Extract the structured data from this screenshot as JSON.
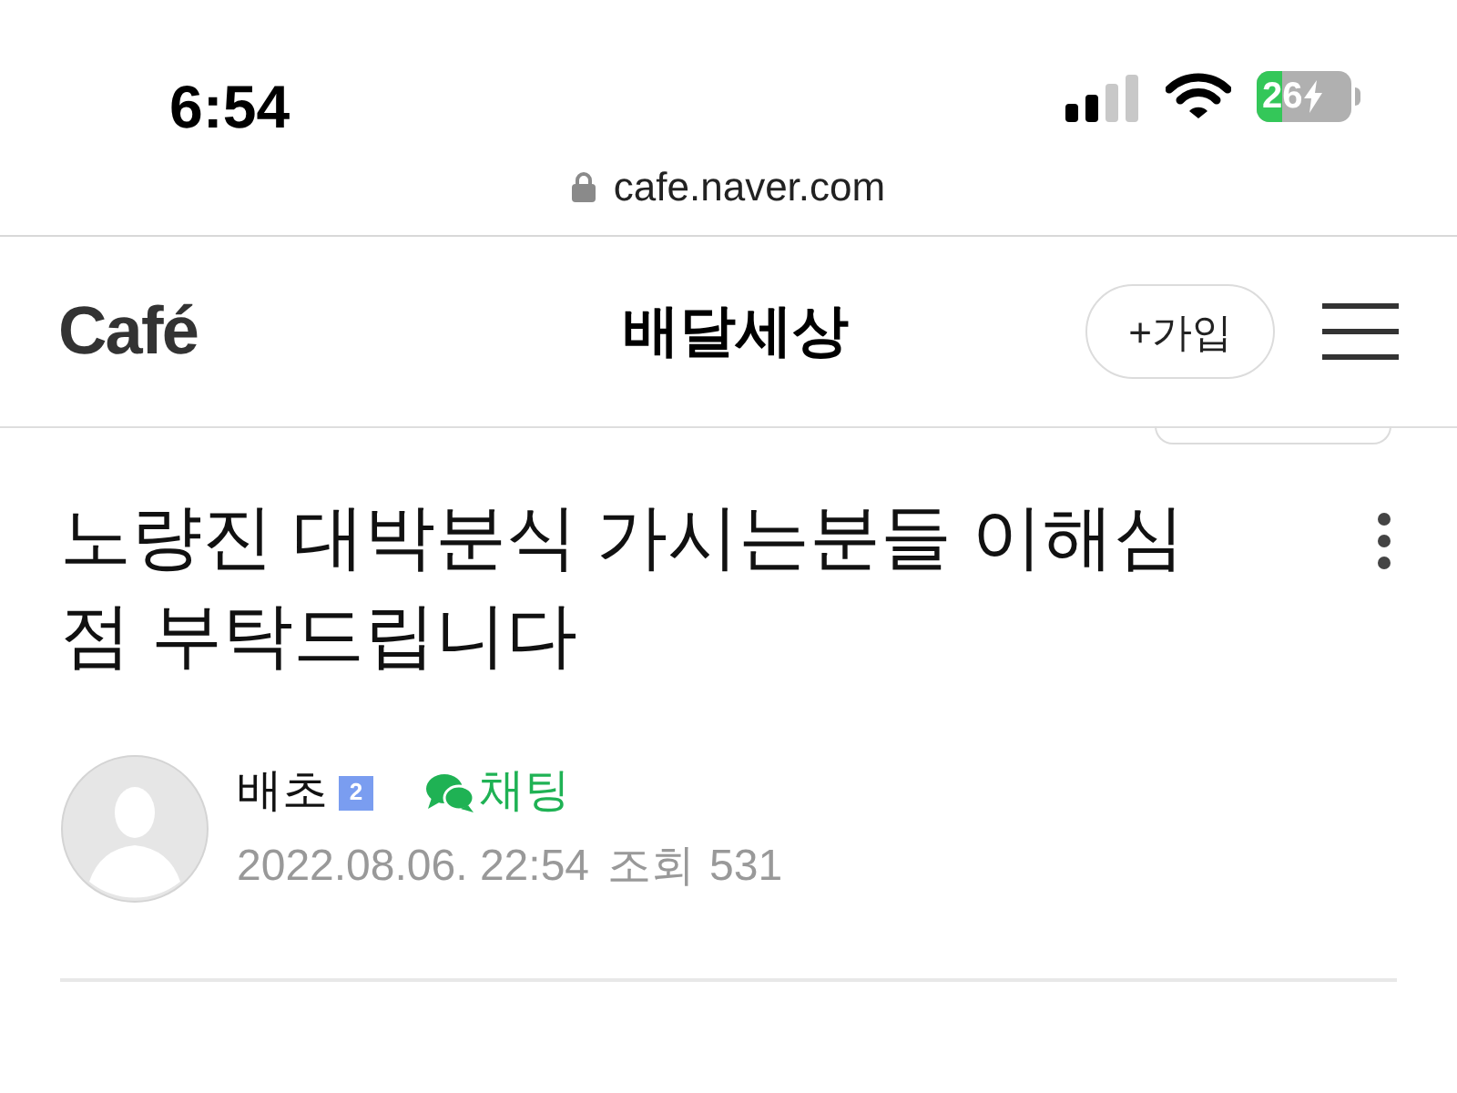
{
  "status_bar": {
    "time": "6:54",
    "battery": "26",
    "url": "cafe.naver.com"
  },
  "header": {
    "logo": "Café",
    "cafe_name": "배달세상",
    "join_button": "+가입"
  },
  "post": {
    "title": "노량진 대박분식 가시는분들 이해심 점 부탁드립니다",
    "author": "배초",
    "level_badge": "2",
    "chat_label": "채팅",
    "date": "2022.08.06. 22:54",
    "views_label": "조회",
    "views": "531"
  }
}
